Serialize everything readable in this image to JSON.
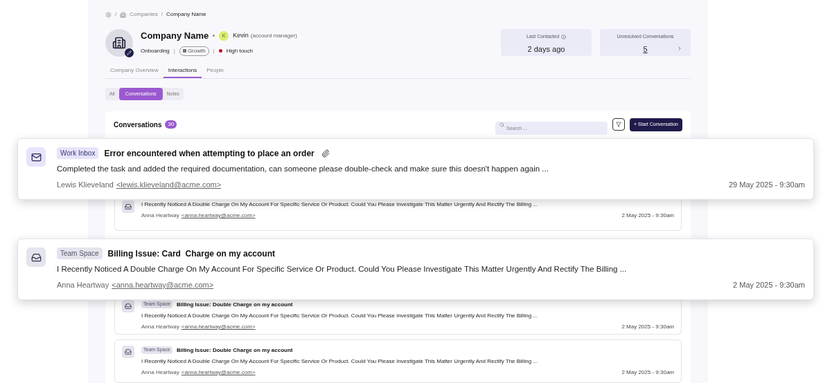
{
  "breadcrumb": [
    {
      "label": "/",
      "kind": "separator"
    },
    {
      "label": "Companies",
      "kind": "companies"
    },
    {
      "label": "/",
      "kind": "separator"
    },
    {
      "label": "Company Name",
      "kind": "current"
    }
  ],
  "company": {
    "name": "Company Name",
    "manager": {
      "initial": "K",
      "name": "Kevin",
      "role": "(account manager)"
    },
    "meta": [
      {
        "kind": "text",
        "label": "Onboarding"
      },
      {
        "kind": "divider",
        "label": "|"
      },
      {
        "kind": "badge",
        "label": "Growth"
      },
      {
        "kind": "divider",
        "label": "|"
      },
      {
        "kind": "status",
        "label": "High touch"
      }
    ]
  },
  "stats": [
    {
      "label": "Last Contacted",
      "value": "2 days ago",
      "kind": "info"
    },
    {
      "label": "Unresolved Conversations",
      "value": "5",
      "kind": "link"
    }
  ],
  "tabs": [
    {
      "label": "Company Overview",
      "selected": false
    },
    {
      "label": "Interactions",
      "selected": true
    },
    {
      "label": "People",
      "selected": false
    }
  ],
  "filters": [
    {
      "label": "All",
      "selected": false
    },
    {
      "label": "Conversations",
      "selected": true
    },
    {
      "label": "Notes",
      "selected": false
    }
  ],
  "conversations": {
    "title": "Conversations",
    "count": "30",
    "search": {
      "placeholder": "Search ..."
    },
    "start_button": "+ Start Conversation",
    "rows": [
      {
        "body": "I Recently Noticed A Double Charge On My Account For Specific Service Or Product. Could You Please Investigate This Matter Urgently And Rectify The Billing ...",
        "sender": "Anna Heartway",
        "email": "<anna.heartway@acme.com>",
        "date": "2 May 2025 - 9:30am"
      },
      {
        "tag": "Team Space",
        "title": "Billing Issue: Double Charge on my account",
        "body": "I Recently Noticed A Double Charge On My Account For Specific Service Or Product. Could You Please Investigate This Matter Urgently And Rectify The Billing ...",
        "sender": "Anna Heartway",
        "email": "<anna.heartway@acme.com>",
        "date": "2 May 2025 - 9:30am"
      },
      {
        "tag": "Team Space",
        "title": "Billing Issue: Double Charge on my account",
        "body": "I Recently Noticed A Double Charge On My Account For Specific Service Or Product. Could You Please Investigate This Matter Urgently And Rectify The Billing ...",
        "sender": "Anna Heartway",
        "email": "<anna.heartway@acme.com>",
        "date": "2 May 2025 - 9:30am"
      }
    ]
  },
  "featured": [
    {
      "kind": "inbox",
      "tag": "Work Inbox",
      "title": "Error encountered when attempting to place an order",
      "attachment": true,
      "body": "Completed the task and added the required documentation, can someone please double-check and make sure this doesn't happen again  ...",
      "sender": "Lewis Klieveland",
      "email": "<lewis.klieveland@acme.com>",
      "date": "29 May 2025 - 9:30am"
    },
    {
      "kind": "team",
      "tag": "Team Space",
      "title": "Billing Issue: Card  Charge on my account",
      "attachment": false,
      "body": "I Recently Noticed A Double Charge On My Account For Specific Service Or Product. Could You Please Investigate This Matter Urgently And Rectify The Billing ...",
      "sender": "Anna Heartway",
      "email": "<anna.heartway@acme.com>",
      "date": "2 May 2025 - 9:30am"
    }
  ]
}
